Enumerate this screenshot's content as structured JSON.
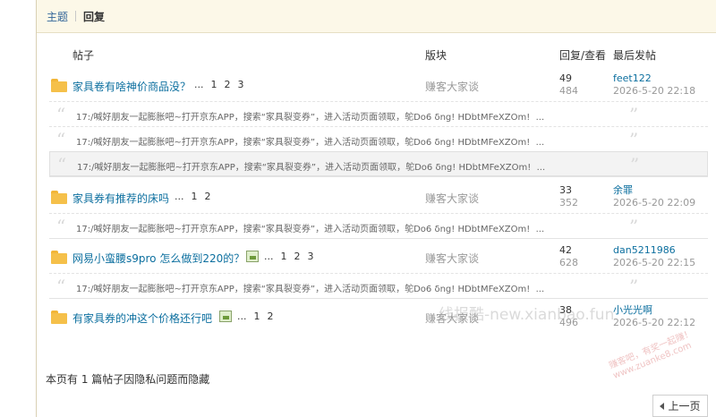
{
  "tabs": {
    "topic": "主题",
    "reply": "回复"
  },
  "headers": {
    "thread": "帖子",
    "forum": "版块",
    "stats": "回复/查看",
    "last": "最后发帖"
  },
  "quote_text": "17:/喊好朋友一起膨胀吧~打开京东APP，搜索“家具裂变券”，进入活动页面领取，鸵Do6 δng! HDbtMFeXZOm!",
  "quote_more": "...",
  "threads": [
    {
      "title": "家具卷有啥神价商品没？",
      "ellipsis": "...",
      "pages": [
        "1",
        "2",
        "3"
      ],
      "forum": "赚客大家谈",
      "replies": "49",
      "views": "484",
      "user": "feet122",
      "time": "2026-5-20 22:18",
      "has_image": false
    },
    {
      "title": "家具券有推荐的床吗",
      "ellipsis": "...",
      "pages": [
        "1",
        "2"
      ],
      "forum": "赚客大家谈",
      "replies": "33",
      "views": "352",
      "user": "余罪",
      "time": "2026-5-20 22:09",
      "has_image": false
    },
    {
      "title": "网易小蛮腰s9pro 怎么做到220的？",
      "ellipsis": "...",
      "pages": [
        "1",
        "2",
        "3"
      ],
      "forum": "赚客大家谈",
      "replies": "42",
      "views": "628",
      "user": "dan5211986",
      "time": "2026-5-20 22:15",
      "has_image": true
    },
    {
      "title": "有家具券的冲这个价格还行吧",
      "ellipsis": "...",
      "pages": [
        "1",
        "2"
      ],
      "forum": "赚客大家谈",
      "replies": "38",
      "views": "496",
      "user": "小光光啊",
      "time": "2026-5-20 22:12",
      "has_image": true
    }
  ],
  "hidden_note": "本页有 1 篇帖子因隐私问题而隐藏",
  "prev_button": "上一页",
  "watermark": "线报酷-new.xianbao.fun",
  "stamp_lines": [
    "赚客吧，有奖一起赚！",
    "www.zuanke8.com"
  ]
}
